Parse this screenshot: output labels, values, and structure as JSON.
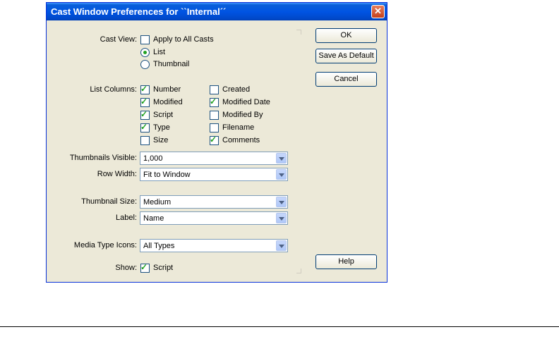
{
  "window": {
    "title": "Cast Window Preferences for ``Internal´´",
    "close": "✕"
  },
  "labels": {
    "cast_view": "Cast View:",
    "list_columns": "List Columns:",
    "thumbnails_visible": "Thumbnails Visible:",
    "row_width": "Row Width:",
    "thumbnail_size": "Thumbnail Size:",
    "label": "Label:",
    "media_type_icons": "Media Type Icons:",
    "show": "Show:"
  },
  "cast_view": {
    "apply_all": {
      "label": "Apply to All Casts",
      "checked": false
    },
    "view_mode": [
      {
        "label": "List",
        "selected": true
      },
      {
        "label": "Thumbnail",
        "selected": false
      }
    ]
  },
  "list_columns": {
    "left": [
      {
        "label": "Number",
        "checked": true
      },
      {
        "label": "Modified",
        "checked": true
      },
      {
        "label": "Script",
        "checked": true
      },
      {
        "label": "Type",
        "checked": true
      },
      {
        "label": "Size",
        "checked": false
      }
    ],
    "right": [
      {
        "label": "Created",
        "checked": false
      },
      {
        "label": "Modified Date",
        "checked": true
      },
      {
        "label": "Modified By",
        "checked": false
      },
      {
        "label": "Filename",
        "checked": false
      },
      {
        "label": "Comments",
        "checked": true
      }
    ]
  },
  "selects": {
    "thumbnails_visible": "1,000",
    "row_width": "Fit to Window",
    "thumbnail_size": "Medium",
    "label": "Name",
    "media_type_icons": "All Types"
  },
  "show": {
    "label": "Script",
    "checked": true
  },
  "buttons": {
    "ok": "OK",
    "save_default": "Save As Default",
    "cancel": "Cancel",
    "help": "Help"
  }
}
